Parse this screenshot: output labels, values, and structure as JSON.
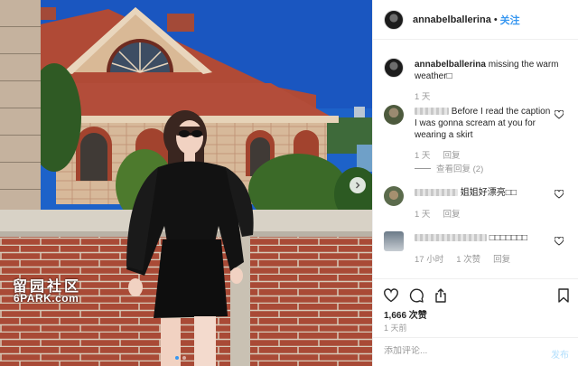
{
  "post": {
    "username": "annabelballerina",
    "separator": "•",
    "follow_label": "关注",
    "caption": {
      "username": "annabelballerina",
      "text": "missing the warm weather□"
    },
    "caption_time": "1 天",
    "watermark": {
      "line1": "留园社区",
      "line2": "6PARK.com"
    },
    "carousel": {
      "index": 1,
      "count": 2
    }
  },
  "comments": [
    {
      "text": "Before I read the caption I was gonna scream at you for wearing a skirt",
      "time": "1 天",
      "reply_label": "回复",
      "view_replies": "查看回复 (2)"
    },
    {
      "text": "姐姐好漂亮□□",
      "time": "1 天",
      "reply_label": "回复"
    },
    {
      "text": "□□□□□□□",
      "time": "17 小时",
      "likes": "1 次赞",
      "reply_label": "回复"
    }
  ],
  "icons": {
    "like": "heart-icon",
    "comment": "comment-icon",
    "share": "share-icon",
    "save": "bookmark-icon"
  },
  "engagement": {
    "likes": "1,666 次赞",
    "date": "1 天前"
  },
  "composer": {
    "placeholder": "添加评论...",
    "post_label": "发布"
  },
  "colors": {
    "accent": "#3897f0",
    "sky": "#1f63c8",
    "text": "#262626",
    "muted": "#999999"
  }
}
